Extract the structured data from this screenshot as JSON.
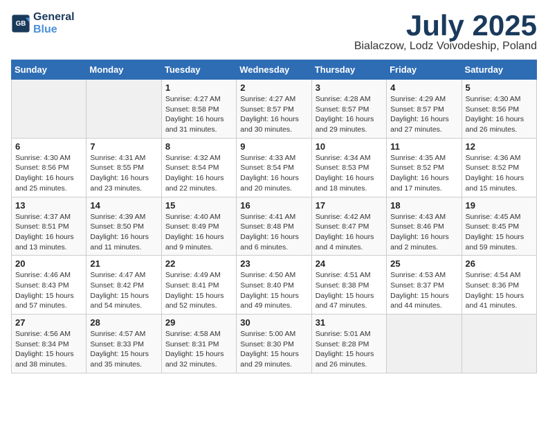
{
  "logo": {
    "line1": "General",
    "line2": "Blue"
  },
  "title": "July 2025",
  "subtitle": "Bialaczow, Lodz Voivodeship, Poland",
  "days_of_week": [
    "Sunday",
    "Monday",
    "Tuesday",
    "Wednesday",
    "Thursday",
    "Friday",
    "Saturday"
  ],
  "weeks": [
    [
      {
        "day": "",
        "info": ""
      },
      {
        "day": "",
        "info": ""
      },
      {
        "day": "1",
        "info": "Sunrise: 4:27 AM\nSunset: 8:58 PM\nDaylight: 16 hours and 31 minutes."
      },
      {
        "day": "2",
        "info": "Sunrise: 4:27 AM\nSunset: 8:57 PM\nDaylight: 16 hours and 30 minutes."
      },
      {
        "day": "3",
        "info": "Sunrise: 4:28 AM\nSunset: 8:57 PM\nDaylight: 16 hours and 29 minutes."
      },
      {
        "day": "4",
        "info": "Sunrise: 4:29 AM\nSunset: 8:57 PM\nDaylight: 16 hours and 27 minutes."
      },
      {
        "day": "5",
        "info": "Sunrise: 4:30 AM\nSunset: 8:56 PM\nDaylight: 16 hours and 26 minutes."
      }
    ],
    [
      {
        "day": "6",
        "info": "Sunrise: 4:30 AM\nSunset: 8:56 PM\nDaylight: 16 hours and 25 minutes."
      },
      {
        "day": "7",
        "info": "Sunrise: 4:31 AM\nSunset: 8:55 PM\nDaylight: 16 hours and 23 minutes."
      },
      {
        "day": "8",
        "info": "Sunrise: 4:32 AM\nSunset: 8:54 PM\nDaylight: 16 hours and 22 minutes."
      },
      {
        "day": "9",
        "info": "Sunrise: 4:33 AM\nSunset: 8:54 PM\nDaylight: 16 hours and 20 minutes."
      },
      {
        "day": "10",
        "info": "Sunrise: 4:34 AM\nSunset: 8:53 PM\nDaylight: 16 hours and 18 minutes."
      },
      {
        "day": "11",
        "info": "Sunrise: 4:35 AM\nSunset: 8:52 PM\nDaylight: 16 hours and 17 minutes."
      },
      {
        "day": "12",
        "info": "Sunrise: 4:36 AM\nSunset: 8:52 PM\nDaylight: 16 hours and 15 minutes."
      }
    ],
    [
      {
        "day": "13",
        "info": "Sunrise: 4:37 AM\nSunset: 8:51 PM\nDaylight: 16 hours and 13 minutes."
      },
      {
        "day": "14",
        "info": "Sunrise: 4:39 AM\nSunset: 8:50 PM\nDaylight: 16 hours and 11 minutes."
      },
      {
        "day": "15",
        "info": "Sunrise: 4:40 AM\nSunset: 8:49 PM\nDaylight: 16 hours and 9 minutes."
      },
      {
        "day": "16",
        "info": "Sunrise: 4:41 AM\nSunset: 8:48 PM\nDaylight: 16 hours and 6 minutes."
      },
      {
        "day": "17",
        "info": "Sunrise: 4:42 AM\nSunset: 8:47 PM\nDaylight: 16 hours and 4 minutes."
      },
      {
        "day": "18",
        "info": "Sunrise: 4:43 AM\nSunset: 8:46 PM\nDaylight: 16 hours and 2 minutes."
      },
      {
        "day": "19",
        "info": "Sunrise: 4:45 AM\nSunset: 8:45 PM\nDaylight: 15 hours and 59 minutes."
      }
    ],
    [
      {
        "day": "20",
        "info": "Sunrise: 4:46 AM\nSunset: 8:43 PM\nDaylight: 15 hours and 57 minutes."
      },
      {
        "day": "21",
        "info": "Sunrise: 4:47 AM\nSunset: 8:42 PM\nDaylight: 15 hours and 54 minutes."
      },
      {
        "day": "22",
        "info": "Sunrise: 4:49 AM\nSunset: 8:41 PM\nDaylight: 15 hours and 52 minutes."
      },
      {
        "day": "23",
        "info": "Sunrise: 4:50 AM\nSunset: 8:40 PM\nDaylight: 15 hours and 49 minutes."
      },
      {
        "day": "24",
        "info": "Sunrise: 4:51 AM\nSunset: 8:38 PM\nDaylight: 15 hours and 47 minutes."
      },
      {
        "day": "25",
        "info": "Sunrise: 4:53 AM\nSunset: 8:37 PM\nDaylight: 15 hours and 44 minutes."
      },
      {
        "day": "26",
        "info": "Sunrise: 4:54 AM\nSunset: 8:36 PM\nDaylight: 15 hours and 41 minutes."
      }
    ],
    [
      {
        "day": "27",
        "info": "Sunrise: 4:56 AM\nSunset: 8:34 PM\nDaylight: 15 hours and 38 minutes."
      },
      {
        "day": "28",
        "info": "Sunrise: 4:57 AM\nSunset: 8:33 PM\nDaylight: 15 hours and 35 minutes."
      },
      {
        "day": "29",
        "info": "Sunrise: 4:58 AM\nSunset: 8:31 PM\nDaylight: 15 hours and 32 minutes."
      },
      {
        "day": "30",
        "info": "Sunrise: 5:00 AM\nSunset: 8:30 PM\nDaylight: 15 hours and 29 minutes."
      },
      {
        "day": "31",
        "info": "Sunrise: 5:01 AM\nSunset: 8:28 PM\nDaylight: 15 hours and 26 minutes."
      },
      {
        "day": "",
        "info": ""
      },
      {
        "day": "",
        "info": ""
      }
    ]
  ]
}
